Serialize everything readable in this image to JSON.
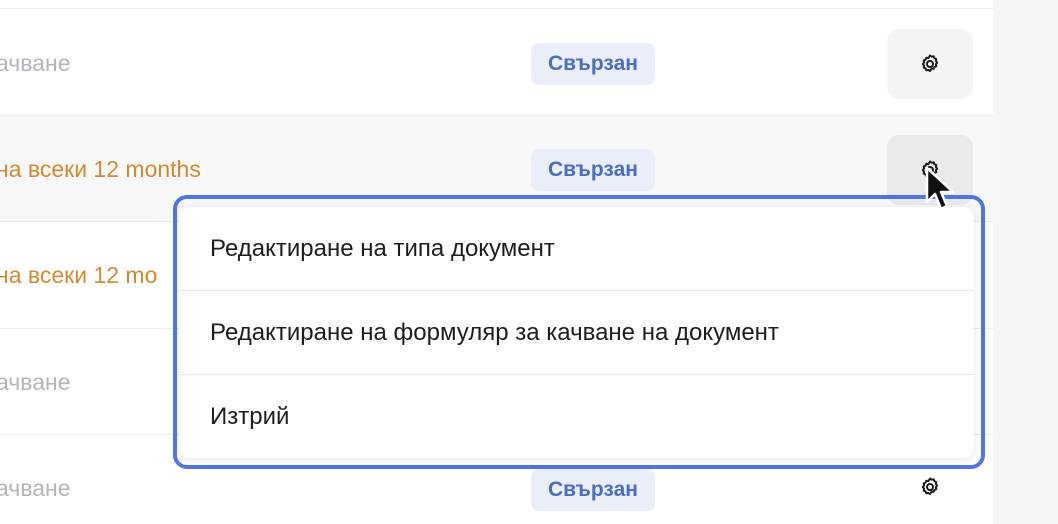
{
  "rows": [
    {
      "text": "ачване",
      "tone": "muted",
      "badge": "Свързан"
    },
    {
      "text": "на всеки 12 months",
      "tone": "warn",
      "badge": "Свързан"
    },
    {
      "text": "на всеки 12 mo",
      "tone": "warn",
      "badge": ""
    },
    {
      "text": "ачване",
      "tone": "muted",
      "badge": ""
    },
    {
      "text": "ачване",
      "tone": "muted",
      "badge": "Свързан"
    }
  ],
  "icons": {
    "row_action": "gear-icon",
    "pointer": "mouse-cursor-icon"
  },
  "context_menu": {
    "items": [
      {
        "label": "Редактиране на типа документ"
      },
      {
        "label": "Редактиране на формуляр за качване на документ"
      },
      {
        "label": "Изтрий"
      }
    ]
  },
  "colors": {
    "highlight_outline": "#4f74e3",
    "badge_bg": "#e9eef8",
    "badge_text": "#4a6ec0",
    "warning_text": "#d08a2d",
    "muted_text": "#b2b4ba"
  }
}
